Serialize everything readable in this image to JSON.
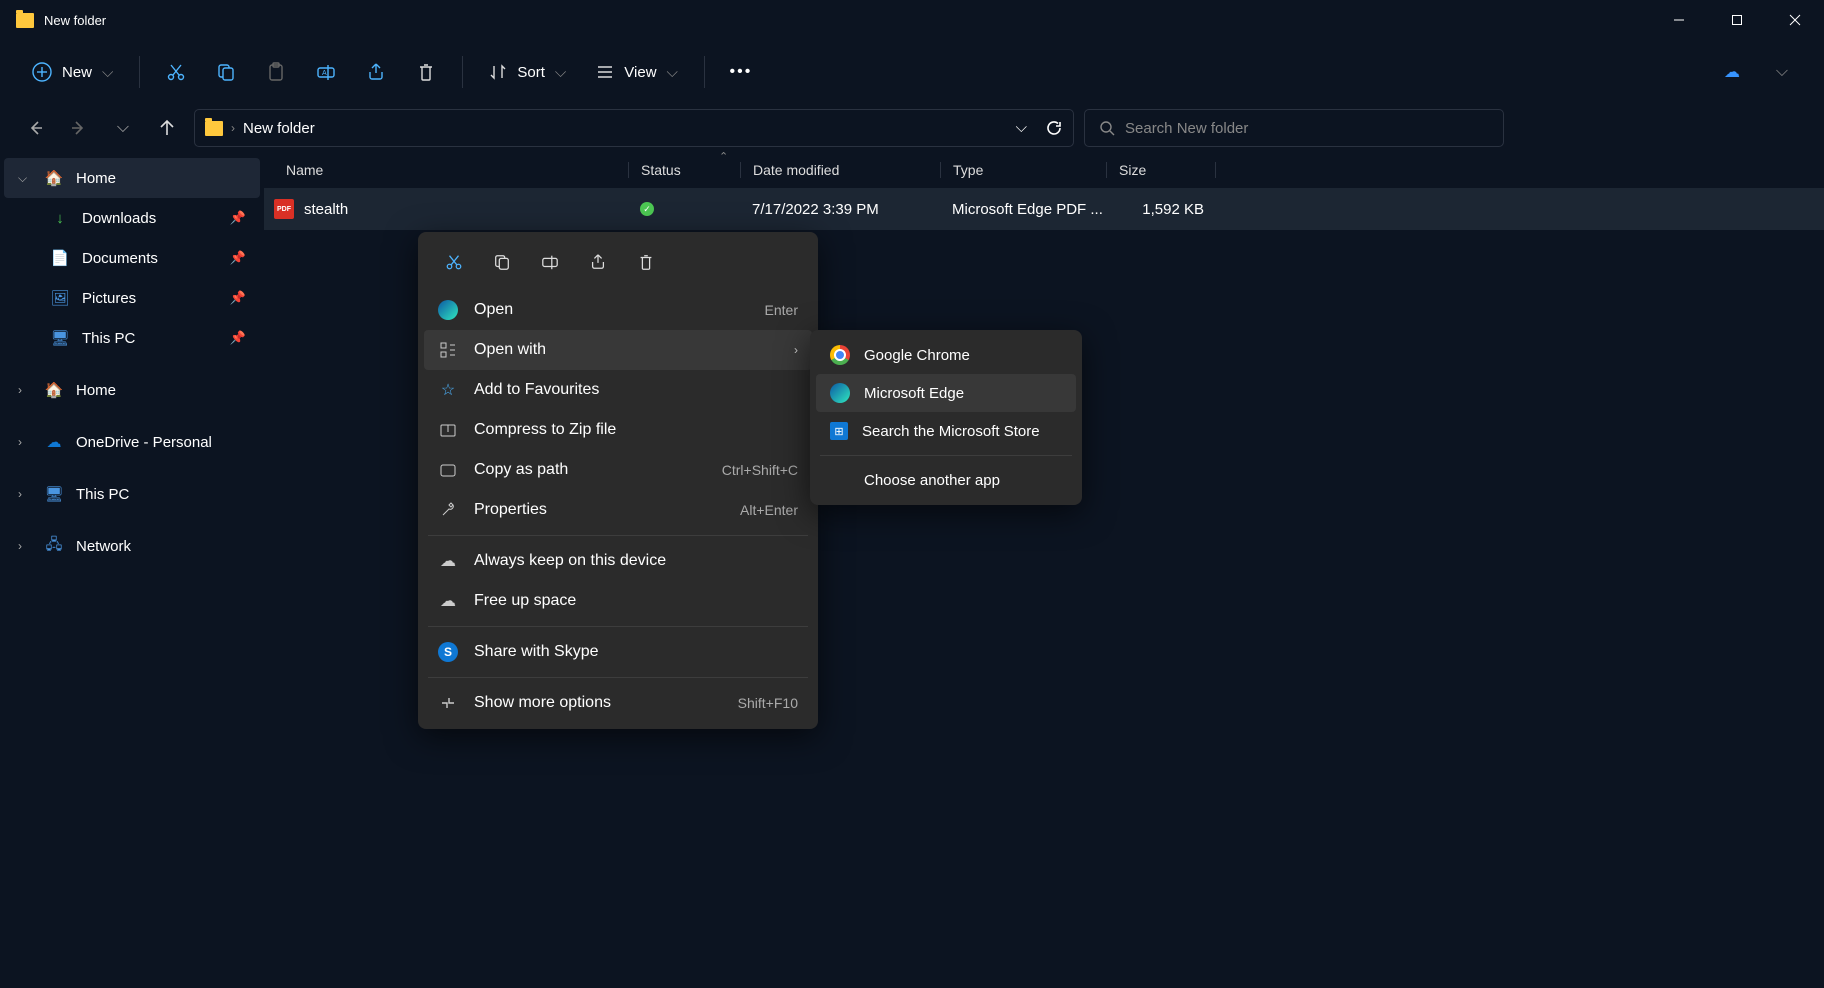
{
  "titlebar": {
    "title": "New folder"
  },
  "toolbar": {
    "new": "New",
    "sort": "Sort",
    "view": "View"
  },
  "addressbar": {
    "path": "New folder"
  },
  "search": {
    "placeholder": "Search New folder"
  },
  "sidebar": {
    "home_sel": "Home",
    "downloads": "Downloads",
    "documents": "Documents",
    "pictures": "Pictures",
    "this_pc_pin": "This PC",
    "home": "Home",
    "onedrive": "OneDrive - Personal",
    "this_pc": "This PC",
    "network": "Network"
  },
  "columns": {
    "name": "Name",
    "status": "Status",
    "date": "Date modified",
    "type": "Type",
    "size": "Size"
  },
  "file": {
    "name": "stealth",
    "date": "7/17/2022 3:39 PM",
    "type": "Microsoft Edge PDF ...",
    "size": "1,592 KB"
  },
  "ctx": {
    "open": "Open",
    "open_sc": "Enter",
    "open_with": "Open with",
    "fav": "Add to Favourites",
    "zip": "Compress to Zip file",
    "copy_path": "Copy as path",
    "copy_path_sc": "Ctrl+Shift+C",
    "props": "Properties",
    "props_sc": "Alt+Enter",
    "keep": "Always keep on this device",
    "free": "Free up space",
    "skype": "Share with Skype",
    "more": "Show more options",
    "more_sc": "Shift+F10"
  },
  "submenu": {
    "chrome": "Google Chrome",
    "edge": "Microsoft Edge",
    "store": "Search the Microsoft Store",
    "another": "Choose another app"
  }
}
